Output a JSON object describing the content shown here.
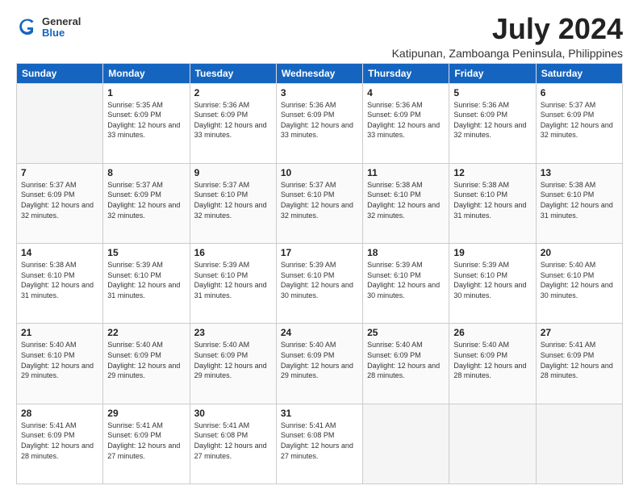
{
  "header": {
    "logo": {
      "general": "General",
      "blue": "Blue"
    },
    "month": "July 2024",
    "location": "Katipunan, Zamboanga Peninsula, Philippines"
  },
  "calendar": {
    "days_of_week": [
      "Sunday",
      "Monday",
      "Tuesday",
      "Wednesday",
      "Thursday",
      "Friday",
      "Saturday"
    ],
    "weeks": [
      [
        {
          "day": "",
          "empty": true
        },
        {
          "day": "1",
          "sunrise": "5:35 AM",
          "sunset": "6:09 PM",
          "daylight": "12 hours and 33 minutes."
        },
        {
          "day": "2",
          "sunrise": "5:36 AM",
          "sunset": "6:09 PM",
          "daylight": "12 hours and 33 minutes."
        },
        {
          "day": "3",
          "sunrise": "5:36 AM",
          "sunset": "6:09 PM",
          "daylight": "12 hours and 33 minutes."
        },
        {
          "day": "4",
          "sunrise": "5:36 AM",
          "sunset": "6:09 PM",
          "daylight": "12 hours and 33 minutes."
        },
        {
          "day": "5",
          "sunrise": "5:36 AM",
          "sunset": "6:09 PM",
          "daylight": "12 hours and 32 minutes."
        },
        {
          "day": "6",
          "sunrise": "5:37 AM",
          "sunset": "6:09 PM",
          "daylight": "12 hours and 32 minutes."
        }
      ],
      [
        {
          "day": "7",
          "sunrise": "5:37 AM",
          "sunset": "6:09 PM",
          "daylight": "12 hours and 32 minutes."
        },
        {
          "day": "8",
          "sunrise": "5:37 AM",
          "sunset": "6:09 PM",
          "daylight": "12 hours and 32 minutes."
        },
        {
          "day": "9",
          "sunrise": "5:37 AM",
          "sunset": "6:10 PM",
          "daylight": "12 hours and 32 minutes."
        },
        {
          "day": "10",
          "sunrise": "5:37 AM",
          "sunset": "6:10 PM",
          "daylight": "12 hours and 32 minutes."
        },
        {
          "day": "11",
          "sunrise": "5:38 AM",
          "sunset": "6:10 PM",
          "daylight": "12 hours and 32 minutes."
        },
        {
          "day": "12",
          "sunrise": "5:38 AM",
          "sunset": "6:10 PM",
          "daylight": "12 hours and 31 minutes."
        },
        {
          "day": "13",
          "sunrise": "5:38 AM",
          "sunset": "6:10 PM",
          "daylight": "12 hours and 31 minutes."
        }
      ],
      [
        {
          "day": "14",
          "sunrise": "5:38 AM",
          "sunset": "6:10 PM",
          "daylight": "12 hours and 31 minutes."
        },
        {
          "day": "15",
          "sunrise": "5:39 AM",
          "sunset": "6:10 PM",
          "daylight": "12 hours and 31 minutes."
        },
        {
          "day": "16",
          "sunrise": "5:39 AM",
          "sunset": "6:10 PM",
          "daylight": "12 hours and 31 minutes."
        },
        {
          "day": "17",
          "sunrise": "5:39 AM",
          "sunset": "6:10 PM",
          "daylight": "12 hours and 30 minutes."
        },
        {
          "day": "18",
          "sunrise": "5:39 AM",
          "sunset": "6:10 PM",
          "daylight": "12 hours and 30 minutes."
        },
        {
          "day": "19",
          "sunrise": "5:39 AM",
          "sunset": "6:10 PM",
          "daylight": "12 hours and 30 minutes."
        },
        {
          "day": "20",
          "sunrise": "5:40 AM",
          "sunset": "6:10 PM",
          "daylight": "12 hours and 30 minutes."
        }
      ],
      [
        {
          "day": "21",
          "sunrise": "5:40 AM",
          "sunset": "6:10 PM",
          "daylight": "12 hours and 29 minutes."
        },
        {
          "day": "22",
          "sunrise": "5:40 AM",
          "sunset": "6:09 PM",
          "daylight": "12 hours and 29 minutes."
        },
        {
          "day": "23",
          "sunrise": "5:40 AM",
          "sunset": "6:09 PM",
          "daylight": "12 hours and 29 minutes."
        },
        {
          "day": "24",
          "sunrise": "5:40 AM",
          "sunset": "6:09 PM",
          "daylight": "12 hours and 29 minutes."
        },
        {
          "day": "25",
          "sunrise": "5:40 AM",
          "sunset": "6:09 PM",
          "daylight": "12 hours and 28 minutes."
        },
        {
          "day": "26",
          "sunrise": "5:40 AM",
          "sunset": "6:09 PM",
          "daylight": "12 hours and 28 minutes."
        },
        {
          "day": "27",
          "sunrise": "5:41 AM",
          "sunset": "6:09 PM",
          "daylight": "12 hours and 28 minutes."
        }
      ],
      [
        {
          "day": "28",
          "sunrise": "5:41 AM",
          "sunset": "6:09 PM",
          "daylight": "12 hours and 28 minutes."
        },
        {
          "day": "29",
          "sunrise": "5:41 AM",
          "sunset": "6:09 PM",
          "daylight": "12 hours and 27 minutes."
        },
        {
          "day": "30",
          "sunrise": "5:41 AM",
          "sunset": "6:08 PM",
          "daylight": "12 hours and 27 minutes."
        },
        {
          "day": "31",
          "sunrise": "5:41 AM",
          "sunset": "6:08 PM",
          "daylight": "12 hours and 27 minutes."
        },
        {
          "day": "",
          "empty": true
        },
        {
          "day": "",
          "empty": true
        },
        {
          "day": "",
          "empty": true
        }
      ]
    ]
  }
}
